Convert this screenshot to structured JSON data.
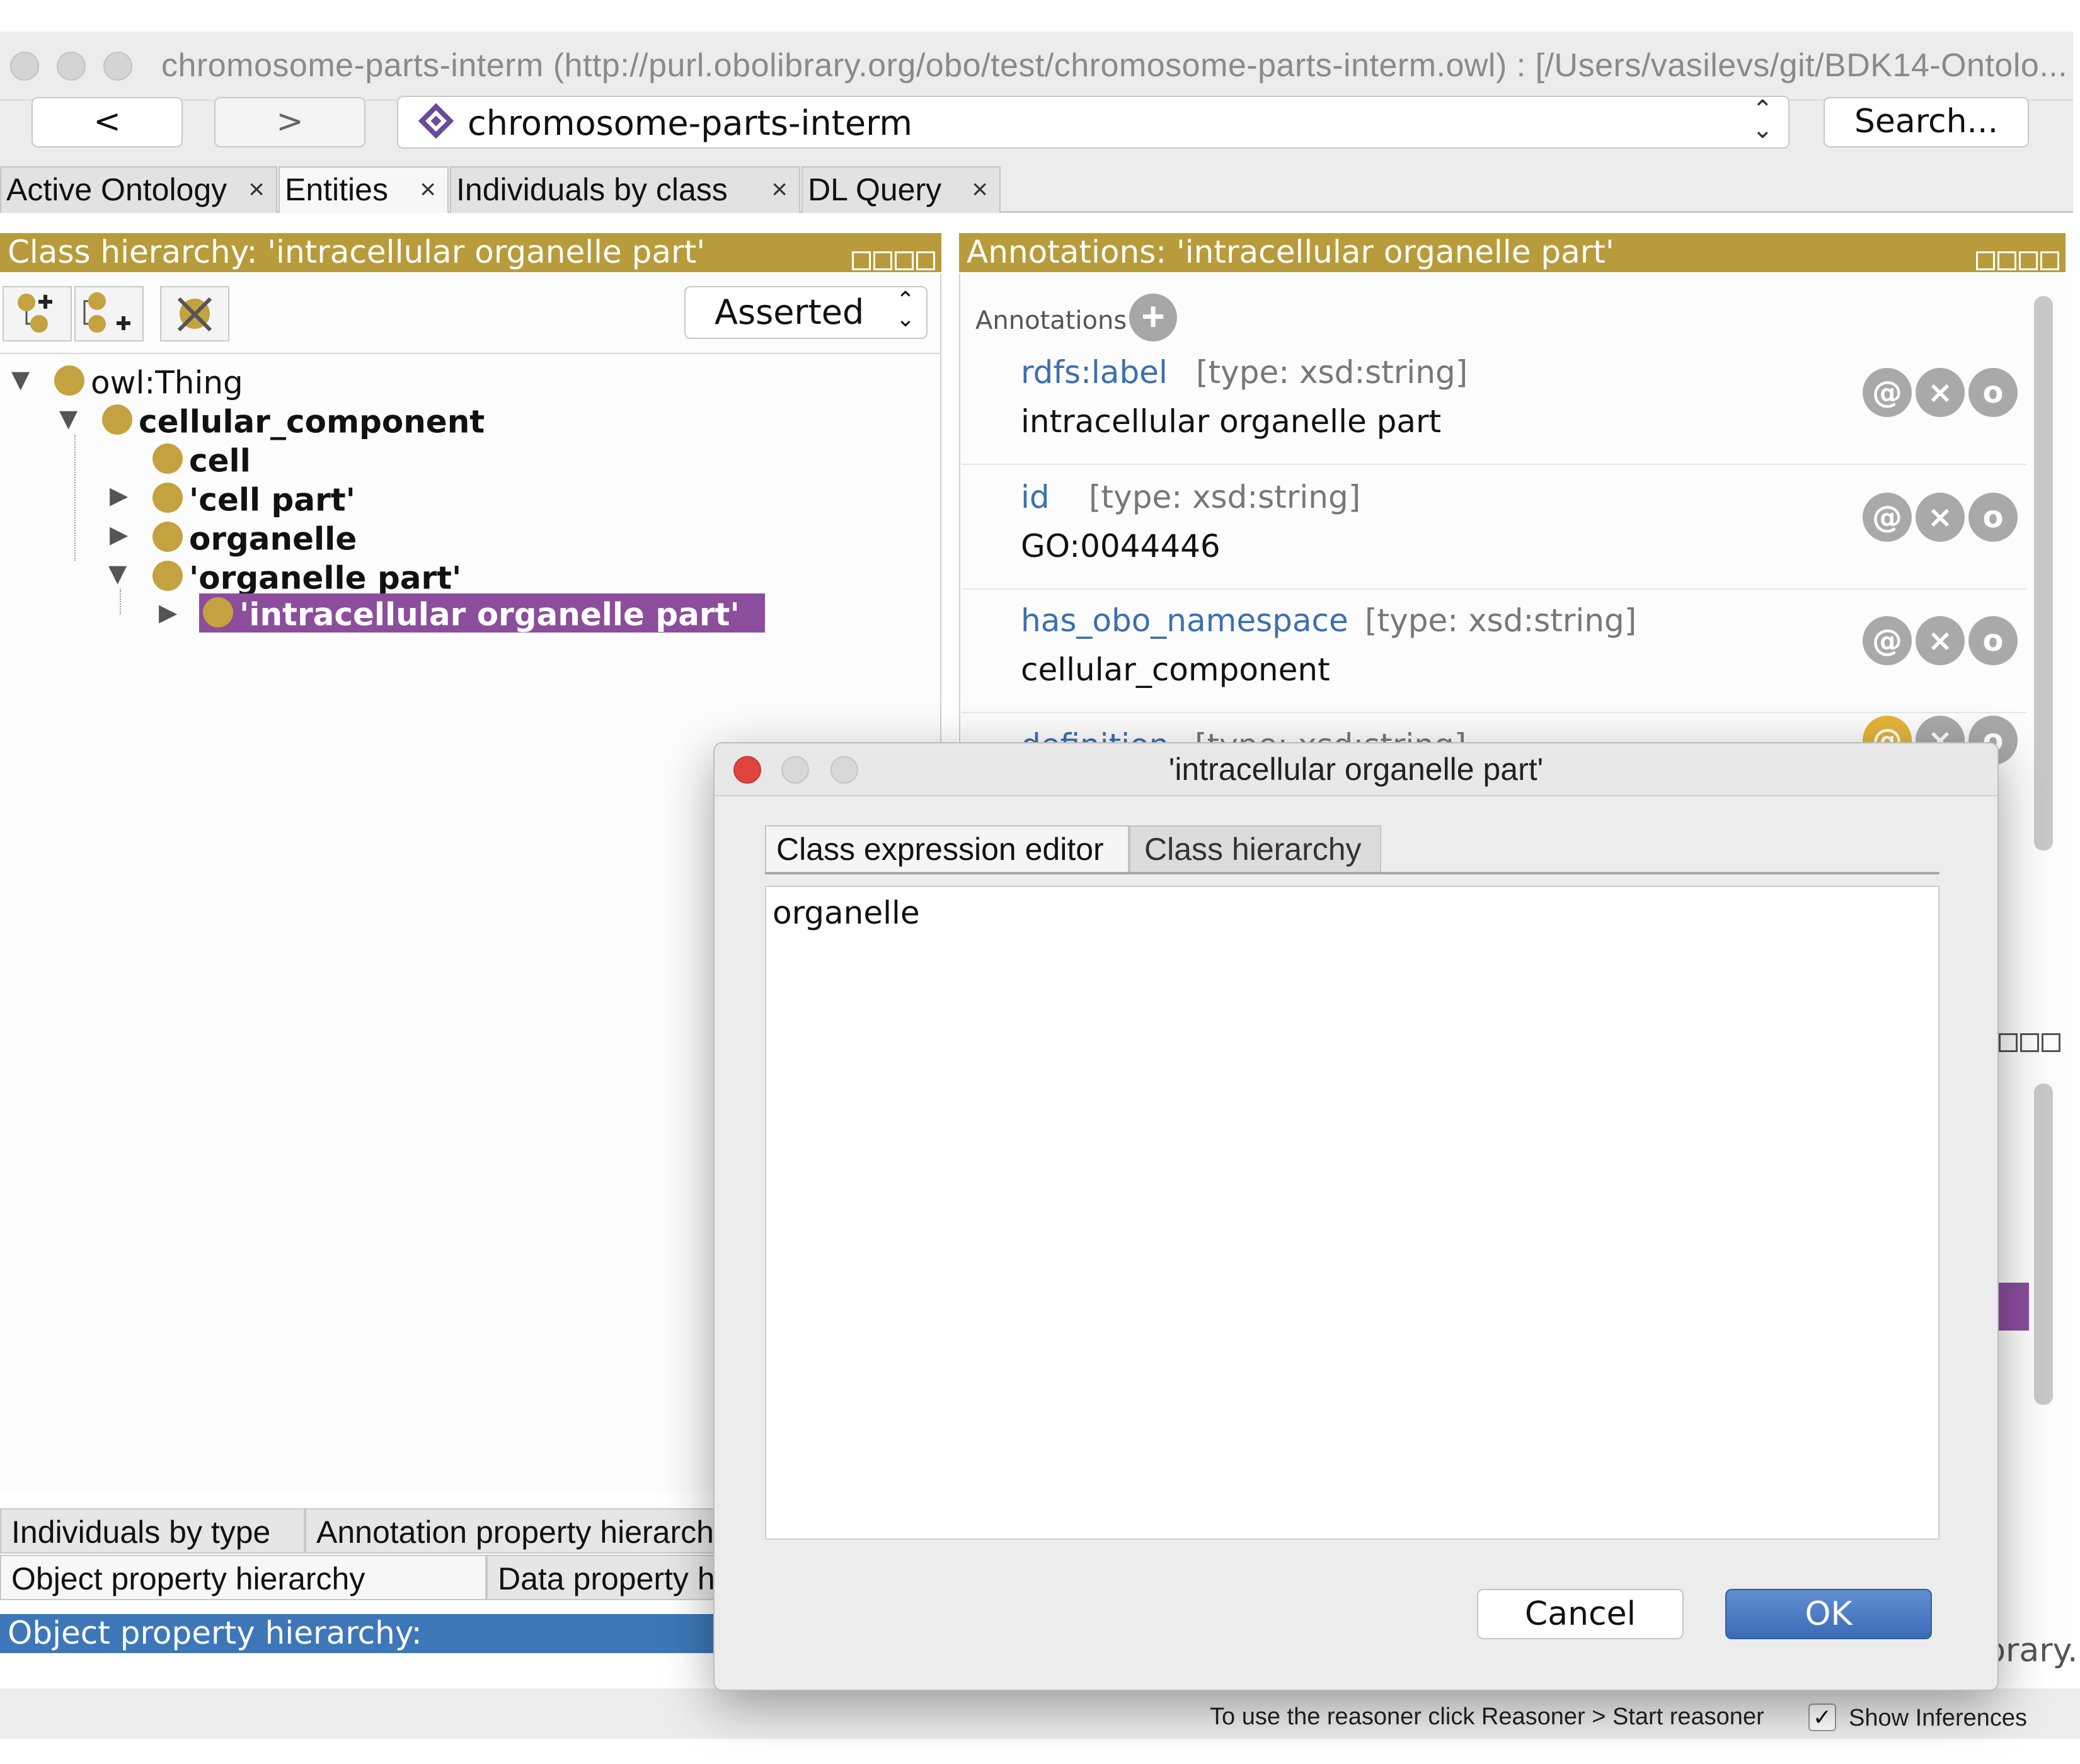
{
  "window": {
    "title": "chromosome-parts-interm (http://purl.obolibrary.org/obo/test/chromosome-parts-interm.owl)  : [/Users/vasilevs/git/BDK14-Ontolo..."
  },
  "toolbar": {
    "back_label": "<",
    "forward_label": ">",
    "ontology_name": "chromosome-parts-interm",
    "search_label": "Search..."
  },
  "tabs": [
    {
      "label": "Active Ontology"
    },
    {
      "label": "Entities"
    },
    {
      "label": "Individuals by class"
    },
    {
      "label": "DL Query"
    }
  ],
  "tab_close": "×",
  "class_hierarchy": {
    "header": "Class hierarchy: 'intracellular organelle part'",
    "mode": "Asserted",
    "tree": [
      {
        "label": "owl:Thing"
      },
      {
        "label": "cellular_component"
      },
      {
        "label": "cell"
      },
      {
        "label": "'cell part'"
      },
      {
        "label": "organelle"
      },
      {
        "label": "'organelle part'"
      },
      {
        "label": "'intracellular organelle part'"
      }
    ]
  },
  "annotations": {
    "header": "Annotations: 'intracellular organelle part'",
    "section_label": "Annotations",
    "rows": [
      {
        "property": "rdfs:label",
        "type": "[type: xsd:string]",
        "value": "intracellular organelle part"
      },
      {
        "property": "id",
        "type": "[type: xsd:string]",
        "value": "GO:0044446"
      },
      {
        "property": "has_obo_namespace",
        "type": "[type: xsd:string]",
        "value": "cellular_component"
      },
      {
        "property": "definition",
        "type": "[type: xsd:string]",
        "value": ""
      }
    ]
  },
  "bottom_tabs": {
    "row1": [
      "Individuals by type",
      "Annotation property hierarch"
    ],
    "row2": [
      "Object property hierarchy",
      "Data property h"
    ],
    "object_property_header": "Object property hierarchy:"
  },
  "right_partial_text": "brary.",
  "status": {
    "reasoner_hint": "To use the reasoner click Reasoner > Start reasoner",
    "show_inferences": "Show Inferences",
    "show_inferences_checked": true
  },
  "dialog": {
    "title": "'intracellular organelle part'",
    "tabs": [
      "Class expression editor",
      "Class hierarchy"
    ],
    "expression": "organelle",
    "cancel_label": "Cancel",
    "ok_label": "OK"
  },
  "colors": {
    "panel_header": "#b89b3a",
    "class_ball": "#c3a23f",
    "selection": "#8c4d9c",
    "property_link": "#3b6fb0",
    "ok_button": "#3b6cb6"
  }
}
